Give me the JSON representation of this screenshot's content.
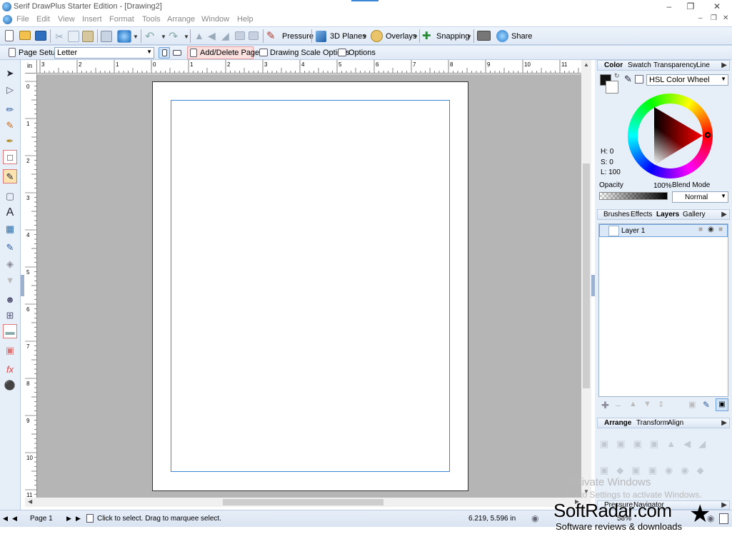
{
  "window": {
    "title": "Serif DrawPlus Starter Edition - [Drawing2]",
    "controls": [
      "–",
      "❐",
      "✕"
    ]
  },
  "menu": [
    "File",
    "Edit",
    "View",
    "Insert",
    "Format",
    "Tools",
    "Arrange",
    "Window",
    "Help"
  ],
  "toolbar1": {
    "pressure": "Pressure",
    "planes": "3D Planes",
    "overlays": "Overlays",
    "snapping": "Snapping",
    "share": "Share"
  },
  "toolbar2": {
    "page_setup": "Page Setup",
    "page_size": "Letter",
    "add_delete": "Add/Delete Pages",
    "scale": "Drawing Scale Options",
    "options": "Options"
  },
  "ruler": {
    "unit": "in",
    "h_ticks": [
      "3",
      "2",
      "1",
      "0",
      "1",
      "2",
      "3",
      "4",
      "5",
      "6",
      "7",
      "8",
      "9",
      "10",
      "11"
    ],
    "v_ticks": [
      "0",
      "1",
      "2",
      "3",
      "4",
      "5",
      "6",
      "7",
      "8",
      "9",
      "10",
      "11"
    ]
  },
  "color_panel": {
    "tabs": [
      "Color",
      "Swatch",
      "Transparency",
      "Line"
    ],
    "mode": "HSL Color Wheel",
    "h": "H: 0",
    "s": "S: 0",
    "l": "L: 100",
    "opacity_label": "Opacity",
    "opacity_value": "100%",
    "blend_label": "Blend Mode",
    "blend_value": "Normal"
  },
  "layers_panel": {
    "tabs": [
      "Brushes",
      "Effects",
      "Layers",
      "Gallery"
    ],
    "layer_name": "Layer 1"
  },
  "arrange_panel": {
    "tabs": [
      "Arrange",
      "Transform",
      "Align"
    ]
  },
  "bottom_panel": {
    "tabs": [
      "Pressure",
      "Navigator"
    ]
  },
  "status": {
    "page": "Page 1",
    "hint": "Click to select. Drag to marquee select.",
    "coords": "6.219,  5.596 in",
    "zoom": "58%"
  },
  "watermark": {
    "line1": "Activate Windows",
    "line2": "Go to Settings to activate Windows.",
    "brand": "SoftRadar.com",
    "tagline": "Software reviews & downloads"
  },
  "colors": {
    "accent": "#3b86d6",
    "toolbar": "#dfe9f5",
    "canvas": "#b5b5b5"
  }
}
